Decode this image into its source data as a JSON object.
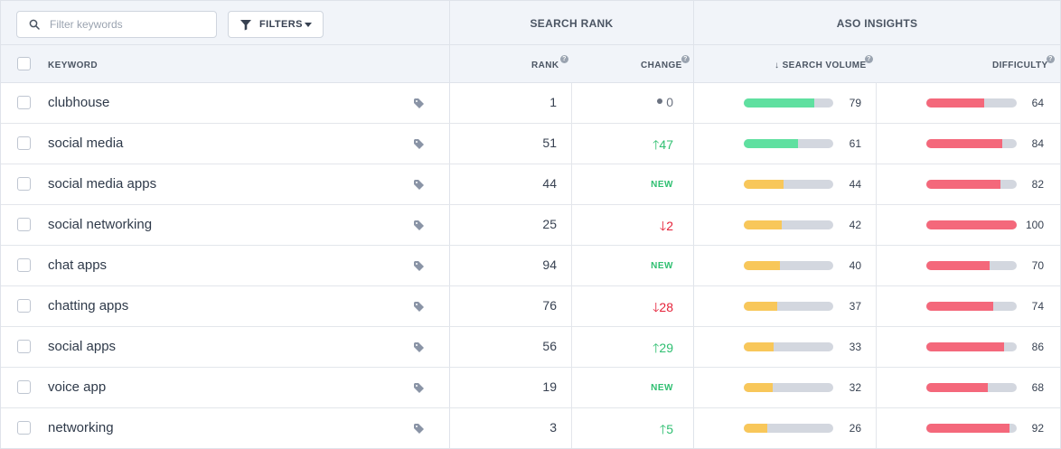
{
  "toolbar": {
    "search_placeholder": "Filter keywords",
    "filters_label": "FILTERS"
  },
  "groups": {
    "search_rank": "SEARCH RANK",
    "aso_insights": "ASO INSIGHTS"
  },
  "columns": {
    "keyword": "KEYWORD",
    "rank": "RANK",
    "change": "CHANGE",
    "search_volume": "SEARCH VOLUME",
    "difficulty": "DIFFICULTY"
  },
  "colors": {
    "up": "#2fbf71",
    "down": "#e5233a",
    "volume_high": "#5fe0a0",
    "volume_low": "#f8c75a",
    "difficulty": "#f4687b",
    "bar_track": "#d3d7df"
  },
  "rows": [
    {
      "keyword": "clubhouse",
      "rank": "1",
      "change_type": "neutral",
      "change": "0",
      "search_volume": 79,
      "difficulty": 64
    },
    {
      "keyword": "social media",
      "rank": "51",
      "change_type": "up",
      "change": "47",
      "search_volume": 61,
      "difficulty": 84
    },
    {
      "keyword": "social media apps",
      "rank": "44",
      "change_type": "new",
      "change": "NEW",
      "search_volume": 44,
      "difficulty": 82
    },
    {
      "keyword": "social networking",
      "rank": "25",
      "change_type": "down",
      "change": "2",
      "search_volume": 42,
      "difficulty": 100
    },
    {
      "keyword": "chat apps",
      "rank": "94",
      "change_type": "new",
      "change": "NEW",
      "search_volume": 40,
      "difficulty": 70
    },
    {
      "keyword": "chatting apps",
      "rank": "76",
      "change_type": "down",
      "change": "28",
      "search_volume": 37,
      "difficulty": 74
    },
    {
      "keyword": "social apps",
      "rank": "56",
      "change_type": "up",
      "change": "29",
      "search_volume": 33,
      "difficulty": 86
    },
    {
      "keyword": "voice app",
      "rank": "19",
      "change_type": "new",
      "change": "NEW",
      "search_volume": 32,
      "difficulty": 68
    },
    {
      "keyword": "networking",
      "rank": "3",
      "change_type": "up",
      "change": "5",
      "search_volume": 26,
      "difficulty": 92
    }
  ]
}
